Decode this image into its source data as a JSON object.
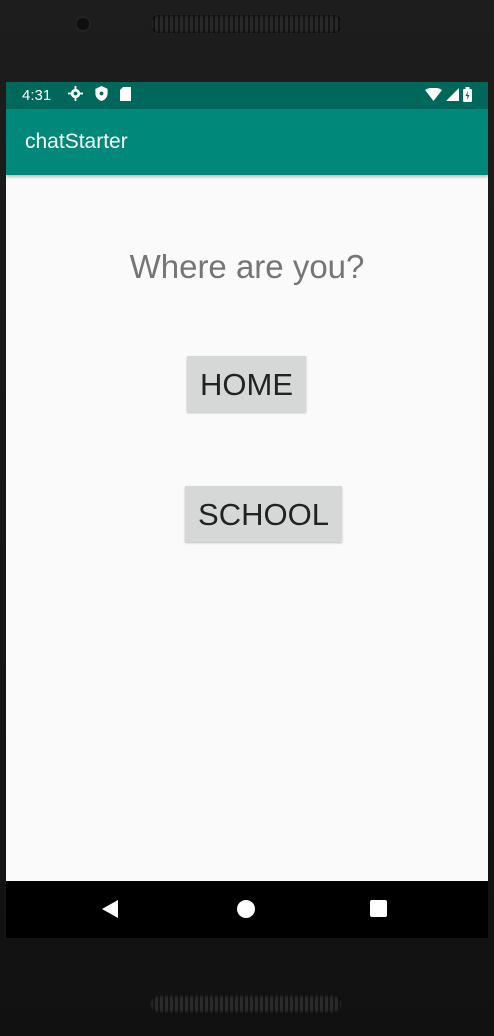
{
  "status": {
    "time": "4:31"
  },
  "appbar": {
    "title": "chatStarter"
  },
  "main": {
    "question": "Where are you?",
    "home_button": "HOME",
    "school_button": "SCHOOL"
  },
  "colors": {
    "statusbar": "#00675b",
    "appbar": "#00897b",
    "button": "#d6d7d7"
  },
  "icons": [
    "gear-icon",
    "shield-icon",
    "sd-card-icon",
    "wifi-icon",
    "signal-icon",
    "battery-icon",
    "back-icon",
    "home-circle-icon",
    "recents-icon"
  ]
}
